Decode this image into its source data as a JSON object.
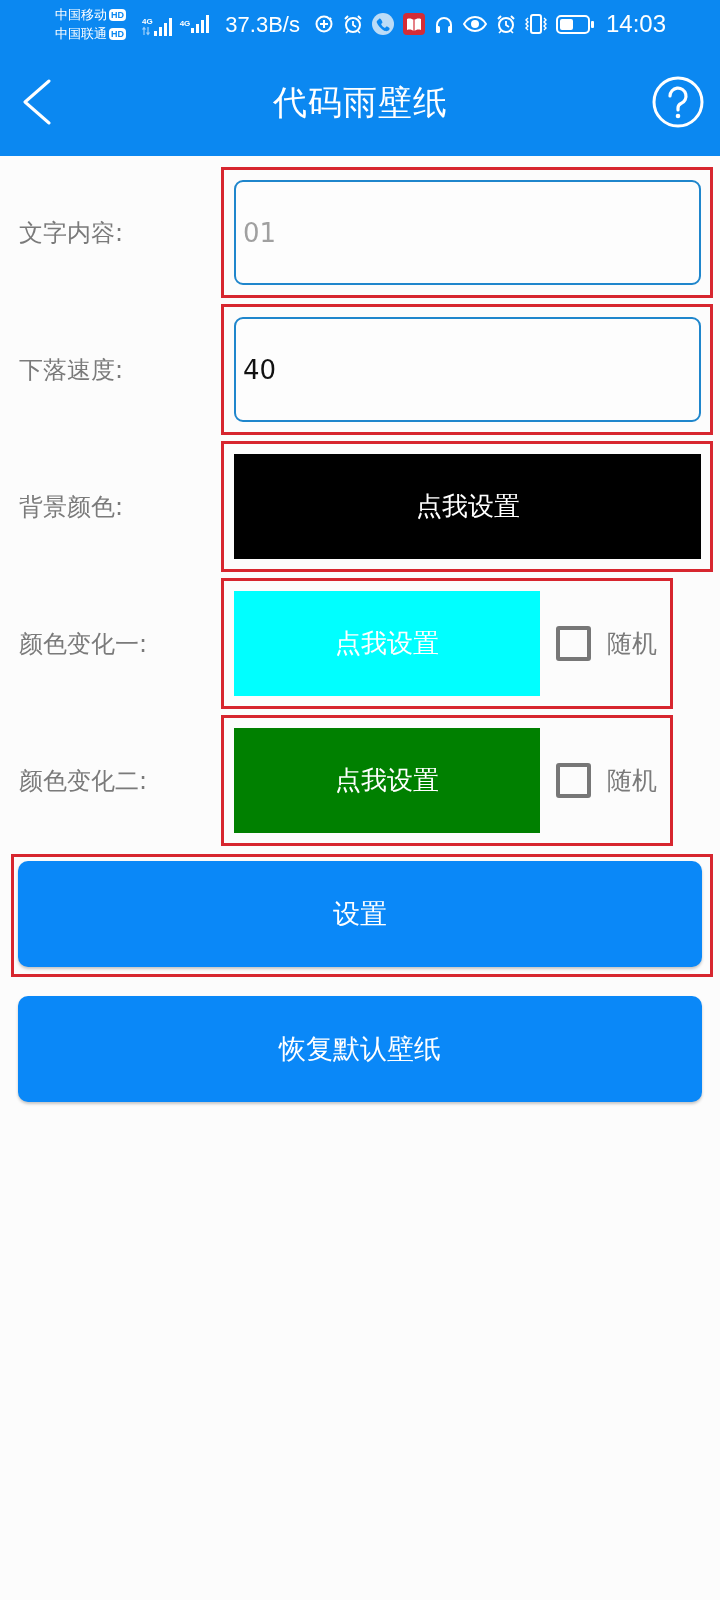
{
  "status_bar": {
    "carriers": [
      {
        "name": "中国移动",
        "badge": "HD"
      },
      {
        "name": "中国联通",
        "badge": "HD"
      }
    ],
    "signals": [
      {
        "label": "4G",
        "activity": true
      },
      {
        "label": "4G",
        "activity": false
      }
    ],
    "network_speed": "37.3B/s",
    "time": "14:03"
  },
  "app_bar": {
    "title": "代码雨壁纸"
  },
  "form": {
    "rows": [
      {
        "kind": "input",
        "label": "文字内容:",
        "placeholder": "01",
        "highlighted": true
      },
      {
        "kind": "input",
        "label": "下落速度:",
        "value": "40",
        "highlighted": true
      },
      {
        "kind": "color",
        "label": "背景颜色:",
        "button": "点我设置",
        "color": "#000000",
        "highlighted": true
      },
      {
        "kind": "color",
        "label": "颜色变化一:",
        "button": "点我设置",
        "color": "#00ffff",
        "random": {
          "label": "随机",
          "checked": false
        },
        "highlighted": true
      },
      {
        "kind": "color",
        "label": "颜色变化二:",
        "button": "点我设置",
        "color": "#008000",
        "random": {
          "label": "随机",
          "checked": false
        },
        "highlighted": true
      }
    ]
  },
  "buttons": [
    {
      "label": "设置",
      "highlighted": true
    },
    {
      "label": "恢复默认壁纸",
      "highlighted": false
    }
  ]
}
